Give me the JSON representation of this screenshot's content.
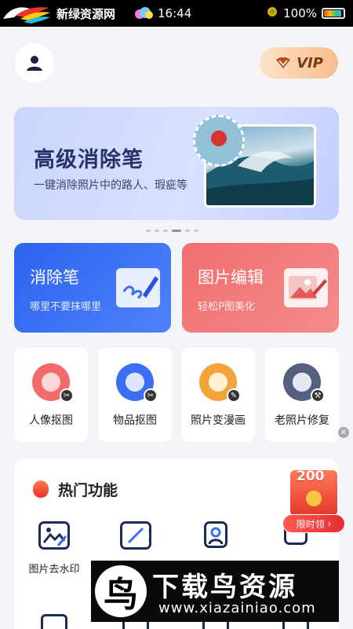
{
  "status_bar": {
    "brand": "新绿资源网",
    "time": "16:44",
    "battery": "100%",
    "icons": [
      "brand-logo-icon",
      "weather-icon",
      "signal-icon",
      "battery-icon"
    ]
  },
  "header": {
    "vip_label": "VIP"
  },
  "banner": {
    "title": "高级消除笔",
    "subtitle": "一键消除照片中的路人、瑕疵等",
    "pages": 6,
    "active_page": 4
  },
  "cards": [
    {
      "title": "消除笔",
      "subtitle": "哪里不要抹哪里",
      "color": "#3a6ef5"
    },
    {
      "title": "图片编辑",
      "subtitle": "轻松P图美化",
      "color": "#f27474"
    }
  ],
  "tools": [
    {
      "label": "人像抠图",
      "icon": "portrait-cutout-icon",
      "color": "#f26b6b"
    },
    {
      "label": "物品抠图",
      "icon": "shopping-bag-icon",
      "color": "#3b6ef2"
    },
    {
      "label": "照片变漫画",
      "icon": "cartoon-icon",
      "color": "#f4a23a"
    },
    {
      "label": "老照片修复",
      "icon": "old-photo-icon",
      "color": "#54607e"
    }
  ],
  "hot": {
    "title": "热门功能",
    "features": [
      {
        "label": "图片去水印",
        "icon": "remove-watermark-icon"
      },
      {
        "label": "",
        "icon": "remove-video-watermark-icon"
      },
      {
        "label": "",
        "icon": "id-photo-icon"
      },
      {
        "label": "",
        "icon": "feature-icon"
      }
    ]
  },
  "promo": {
    "amount": "200",
    "label": "限时领"
  },
  "watermark": {
    "logo_char": "鸟",
    "title": "下载鸟资源",
    "url": "www.xiazainiao.com"
  }
}
